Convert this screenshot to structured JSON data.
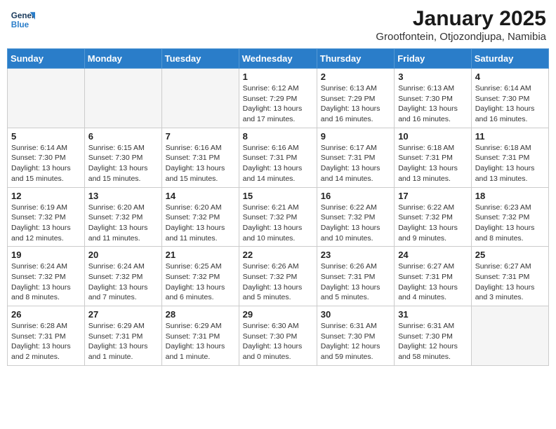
{
  "header": {
    "logo_line1": "General",
    "logo_line2": "Blue",
    "title": "January 2025",
    "subtitle": "Grootfontein, Otjozondjupa, Namibia"
  },
  "weekdays": [
    "Sunday",
    "Monday",
    "Tuesday",
    "Wednesday",
    "Thursday",
    "Friday",
    "Saturday"
  ],
  "weeks": [
    [
      {
        "day": "",
        "info": ""
      },
      {
        "day": "",
        "info": ""
      },
      {
        "day": "",
        "info": ""
      },
      {
        "day": "1",
        "info": "Sunrise: 6:12 AM\nSunset: 7:29 PM\nDaylight: 13 hours\nand 17 minutes."
      },
      {
        "day": "2",
        "info": "Sunrise: 6:13 AM\nSunset: 7:29 PM\nDaylight: 13 hours\nand 16 minutes."
      },
      {
        "day": "3",
        "info": "Sunrise: 6:13 AM\nSunset: 7:30 PM\nDaylight: 13 hours\nand 16 minutes."
      },
      {
        "day": "4",
        "info": "Sunrise: 6:14 AM\nSunset: 7:30 PM\nDaylight: 13 hours\nand 16 minutes."
      }
    ],
    [
      {
        "day": "5",
        "info": "Sunrise: 6:14 AM\nSunset: 7:30 PM\nDaylight: 13 hours\nand 15 minutes."
      },
      {
        "day": "6",
        "info": "Sunrise: 6:15 AM\nSunset: 7:30 PM\nDaylight: 13 hours\nand 15 minutes."
      },
      {
        "day": "7",
        "info": "Sunrise: 6:16 AM\nSunset: 7:31 PM\nDaylight: 13 hours\nand 15 minutes."
      },
      {
        "day": "8",
        "info": "Sunrise: 6:16 AM\nSunset: 7:31 PM\nDaylight: 13 hours\nand 14 minutes."
      },
      {
        "day": "9",
        "info": "Sunrise: 6:17 AM\nSunset: 7:31 PM\nDaylight: 13 hours\nand 14 minutes."
      },
      {
        "day": "10",
        "info": "Sunrise: 6:18 AM\nSunset: 7:31 PM\nDaylight: 13 hours\nand 13 minutes."
      },
      {
        "day": "11",
        "info": "Sunrise: 6:18 AM\nSunset: 7:31 PM\nDaylight: 13 hours\nand 13 minutes."
      }
    ],
    [
      {
        "day": "12",
        "info": "Sunrise: 6:19 AM\nSunset: 7:32 PM\nDaylight: 13 hours\nand 12 minutes."
      },
      {
        "day": "13",
        "info": "Sunrise: 6:20 AM\nSunset: 7:32 PM\nDaylight: 13 hours\nand 11 minutes."
      },
      {
        "day": "14",
        "info": "Sunrise: 6:20 AM\nSunset: 7:32 PM\nDaylight: 13 hours\nand 11 minutes."
      },
      {
        "day": "15",
        "info": "Sunrise: 6:21 AM\nSunset: 7:32 PM\nDaylight: 13 hours\nand 10 minutes."
      },
      {
        "day": "16",
        "info": "Sunrise: 6:22 AM\nSunset: 7:32 PM\nDaylight: 13 hours\nand 10 minutes."
      },
      {
        "day": "17",
        "info": "Sunrise: 6:22 AM\nSunset: 7:32 PM\nDaylight: 13 hours\nand 9 minutes."
      },
      {
        "day": "18",
        "info": "Sunrise: 6:23 AM\nSunset: 7:32 PM\nDaylight: 13 hours\nand 8 minutes."
      }
    ],
    [
      {
        "day": "19",
        "info": "Sunrise: 6:24 AM\nSunset: 7:32 PM\nDaylight: 13 hours\nand 8 minutes."
      },
      {
        "day": "20",
        "info": "Sunrise: 6:24 AM\nSunset: 7:32 PM\nDaylight: 13 hours\nand 7 minutes."
      },
      {
        "day": "21",
        "info": "Sunrise: 6:25 AM\nSunset: 7:32 PM\nDaylight: 13 hours\nand 6 minutes."
      },
      {
        "day": "22",
        "info": "Sunrise: 6:26 AM\nSunset: 7:32 PM\nDaylight: 13 hours\nand 5 minutes."
      },
      {
        "day": "23",
        "info": "Sunrise: 6:26 AM\nSunset: 7:31 PM\nDaylight: 13 hours\nand 5 minutes."
      },
      {
        "day": "24",
        "info": "Sunrise: 6:27 AM\nSunset: 7:31 PM\nDaylight: 13 hours\nand 4 minutes."
      },
      {
        "day": "25",
        "info": "Sunrise: 6:27 AM\nSunset: 7:31 PM\nDaylight: 13 hours\nand 3 minutes."
      }
    ],
    [
      {
        "day": "26",
        "info": "Sunrise: 6:28 AM\nSunset: 7:31 PM\nDaylight: 13 hours\nand 2 minutes."
      },
      {
        "day": "27",
        "info": "Sunrise: 6:29 AM\nSunset: 7:31 PM\nDaylight: 13 hours\nand 1 minute."
      },
      {
        "day": "28",
        "info": "Sunrise: 6:29 AM\nSunset: 7:31 PM\nDaylight: 13 hours\nand 1 minute."
      },
      {
        "day": "29",
        "info": "Sunrise: 6:30 AM\nSunset: 7:30 PM\nDaylight: 13 hours\nand 0 minutes."
      },
      {
        "day": "30",
        "info": "Sunrise: 6:31 AM\nSunset: 7:30 PM\nDaylight: 12 hours\nand 59 minutes."
      },
      {
        "day": "31",
        "info": "Sunrise: 6:31 AM\nSunset: 7:30 PM\nDaylight: 12 hours\nand 58 minutes."
      },
      {
        "day": "",
        "info": ""
      }
    ]
  ]
}
